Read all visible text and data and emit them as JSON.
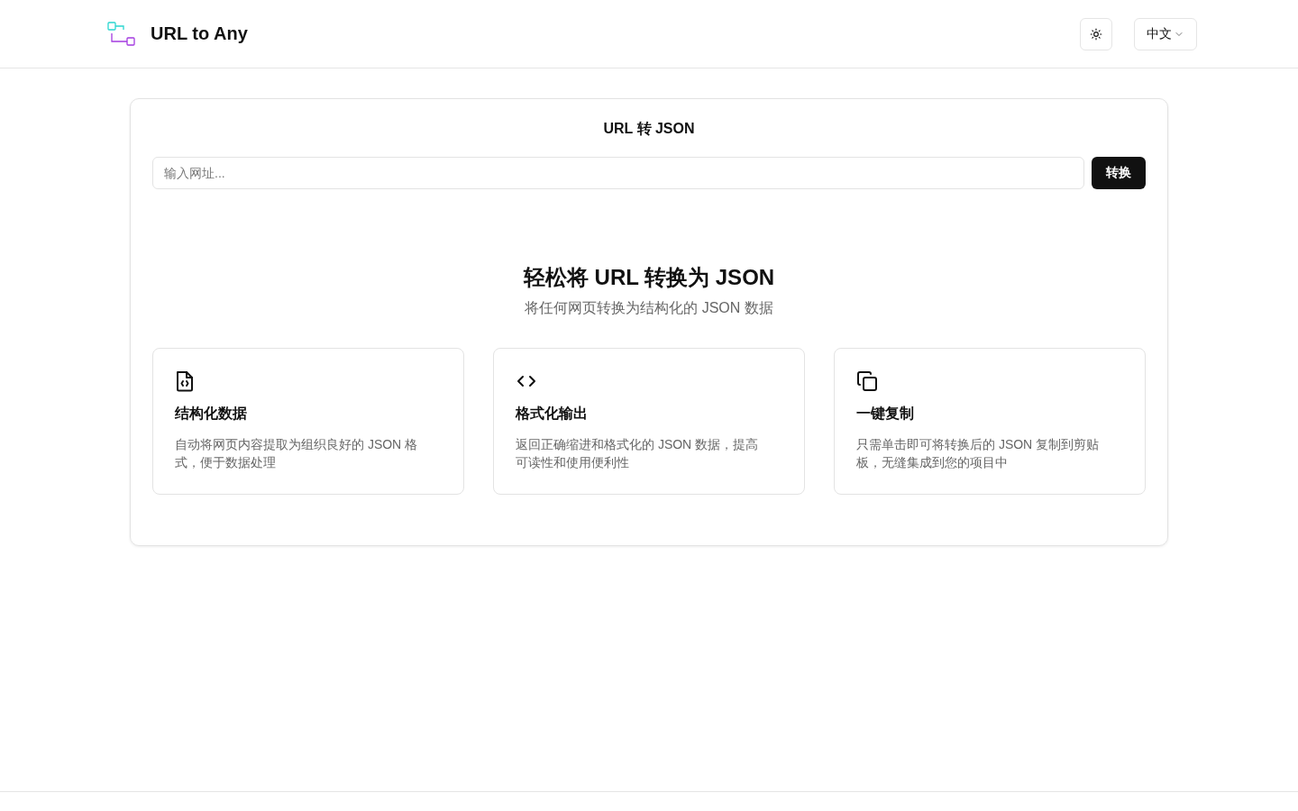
{
  "header": {
    "logo_text": "URL to Any",
    "language": "中文"
  },
  "converter": {
    "title": "URL 转 JSON",
    "url_field": {
      "placeholder": "输入网址..."
    },
    "convert_button": "转换"
  },
  "hero": {
    "heading": "轻松将 URL 转换为 JSON",
    "subheading": "将任何网页转换为结构化的 JSON 数据"
  },
  "features": [
    {
      "kind": "file-code",
      "title": "结构化数据",
      "description": "自动将网页内容提取为组织良好的 JSON 格式，便于数据处理"
    },
    {
      "kind": "code",
      "title": "格式化输出",
      "description": "返回正确缩进和格式化的 JSON 数据，提高可读性和使用便利性"
    },
    {
      "kind": "copy",
      "title": "一键复制",
      "description": "只需单击即可将转换后的 JSON 复制到剪贴板，无缝集成到您的项目中"
    }
  ]
}
